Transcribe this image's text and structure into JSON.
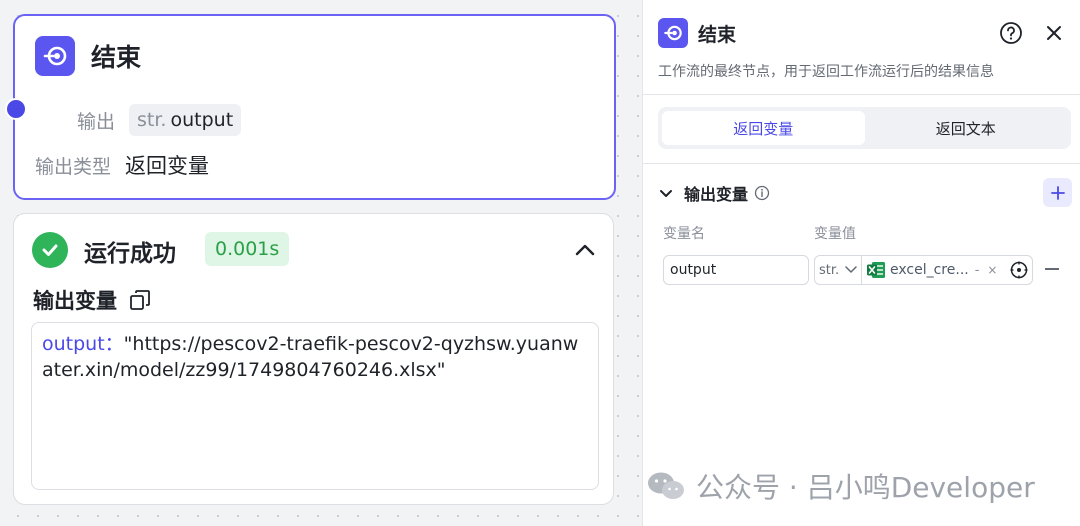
{
  "end_node": {
    "title": "结束",
    "output_label": "输出",
    "output_var_type": "str.",
    "output_var_name": "output",
    "output_type_label": "输出类型",
    "output_type_value": "返回变量"
  },
  "result": {
    "status": "运行成功",
    "duration": "0.001s",
    "section_title": "输出变量",
    "output_key": "output：",
    "output_value": "\"https://pescov2-traefik-pescov2-qyzhsw.yuanwater.xin/model/zz99/1749804760246.xlsx\""
  },
  "panel": {
    "title": "结束",
    "description": "工作流的最终节点，用于返回工作流运行后的结果信息",
    "tabs": [
      {
        "label": "返回变量",
        "active": true
      },
      {
        "label": "返回文本",
        "active": false
      }
    ],
    "section_title": "输出变量",
    "col_name": "变量名",
    "col_value": "变量值",
    "var_name": "output",
    "var_type": "str.",
    "ref_label": "excel_cre...",
    "ref_dash": "-",
    "ref_x": "×"
  },
  "watermark": "公众号 · 吕小鸣Developer",
  "colors": {
    "accent": "#5b56f0",
    "success": "#2fb45a",
    "success_bg": "#dff5e6"
  }
}
